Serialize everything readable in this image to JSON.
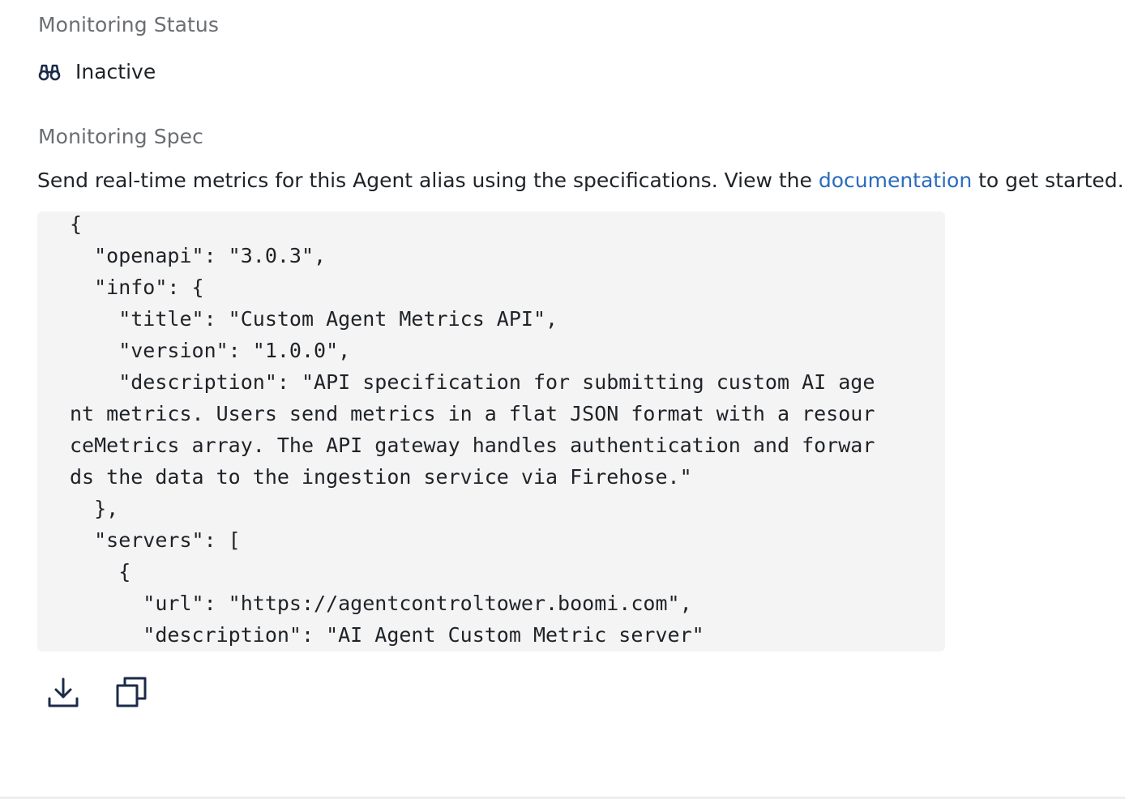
{
  "monitoring_status": {
    "label": "Monitoring Status",
    "icon": "binoculars-icon",
    "value": "Inactive"
  },
  "monitoring_spec": {
    "label": "Monitoring Spec",
    "description_before": "Send real-time metrics for this Agent alias using the specifications. View the ",
    "link_text": "documentation",
    "description_after": " to get started.",
    "code_lines": [
      "{",
      "  \"openapi\": \"3.0.3\",",
      "  \"info\": {",
      "    \"title\": \"Custom Agent Metrics API\",",
      "    \"version\": \"1.0.0\",",
      "    \"description\": \"API specification for submitting custom AI age",
      "nt metrics. Users send metrics in a flat JSON format with a resour",
      "ceMetrics array. The API gateway handles authentication and forwar",
      "ds the data to the ingestion service via Firehose.\"",
      "  },",
      "  \"servers\": [",
      "    {",
      "      \"url\": \"https://agentcontroltower.boomi.com\",",
      "      \"description\": \"AI Agent Custom Metric server\""
    ]
  },
  "actions": {
    "download_icon": "download-icon",
    "copy_icon": "copy-icon"
  },
  "colors": {
    "link": "#2a6bbf",
    "icon": "#1c2b4a",
    "code_bg": "#f4f4f4",
    "label": "#6b6e73"
  }
}
